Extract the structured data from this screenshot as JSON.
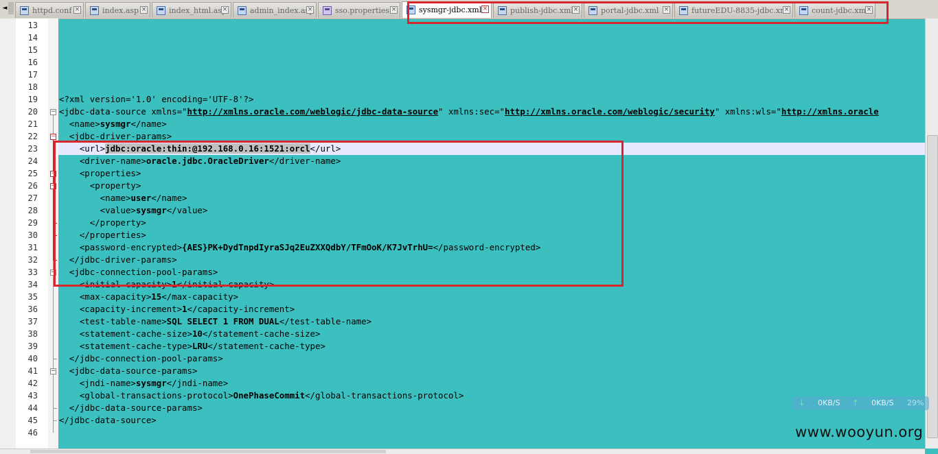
{
  "tabs": [
    {
      "label": "httpd.conf",
      "icon": "file-icon"
    },
    {
      "label": "index.asp",
      "icon": "file-icon"
    },
    {
      "label": "index_html.asp",
      "icon": "file-icon"
    },
    {
      "label": "admin_index.asp",
      "icon": "file-icon"
    },
    {
      "label": "sso.properties",
      "icon": "properties-file-icon"
    },
    {
      "label": "sysmgr-jdbc.xml",
      "icon": "file-icon",
      "active": true
    },
    {
      "label": "publish-jdbc.xml",
      "icon": "file-icon"
    },
    {
      "label": "portal-jdbc.xml",
      "icon": "file-icon"
    },
    {
      "label": "futureEDU-8835-jdbc.xml",
      "icon": "file-icon"
    },
    {
      "label": "count-jdbc.xml",
      "icon": "file-icon"
    }
  ],
  "editor": {
    "background": "#3cbfbf",
    "highlight_color": "#d8262c",
    "lines": [
      {
        "n": "13",
        "text": ""
      },
      {
        "n": "14",
        "text": ""
      },
      {
        "n": "15",
        "text": ""
      },
      {
        "n": "16",
        "text": ""
      },
      {
        "n": "17",
        "text": ""
      },
      {
        "n": "18",
        "text": ""
      },
      {
        "n": "19",
        "text": "<?xml version='1.0' encoding='UTF-8'?>"
      },
      {
        "n": "20",
        "text": "<jdbc-data-source xmlns=\"http://xmlns.oracle.com/weblogic/jdbc-data-source\" xmlns:sec=\"http://xmlns.oracle.com/weblogic/security\" xmlns:wls=\"http://xmlns.oracle"
      },
      {
        "n": "21",
        "text": "  <name>sysmgr</name>"
      },
      {
        "n": "22",
        "text": "  <jdbc-driver-params>"
      },
      {
        "n": "23",
        "text": "    <url>jdbc:oracle:thin:@192.168.0.16:1521:orcl</url>"
      },
      {
        "n": "24",
        "text": "    <driver-name>oracle.jdbc.OracleDriver</driver-name>"
      },
      {
        "n": "25",
        "text": "    <properties>"
      },
      {
        "n": "26",
        "text": "      <property>"
      },
      {
        "n": "27",
        "text": "        <name>user</name>"
      },
      {
        "n": "28",
        "text": "        <value>sysmgr</value>"
      },
      {
        "n": "29",
        "text": "      </property>"
      },
      {
        "n": "30",
        "text": "    </properties>"
      },
      {
        "n": "31",
        "text": "    <password-encrypted>{AES}PK+DydTnpdIyraSJq2EuZXXQdbY/TFmOoK/K7JvTrhU=</password-encrypted>"
      },
      {
        "n": "32",
        "text": "  </jdbc-driver-params>"
      },
      {
        "n": "33",
        "text": "  <jdbc-connection-pool-params>"
      },
      {
        "n": "34",
        "text": "    <initial-capacity>1</initial-capacity>"
      },
      {
        "n": "35",
        "text": "    <max-capacity>15</max-capacity>"
      },
      {
        "n": "36",
        "text": "    <capacity-increment>1</capacity-increment>"
      },
      {
        "n": "37",
        "text": "    <test-table-name>SQL SELECT 1 FROM DUAL</test-table-name>"
      },
      {
        "n": "38",
        "text": "    <statement-cache-size>10</statement-cache-size>"
      },
      {
        "n": "39",
        "text": "    <statement-cache-type>LRU</statement-cache-type>"
      },
      {
        "n": "40",
        "text": "  </jdbc-connection-pool-params>"
      },
      {
        "n": "41",
        "text": "  <jdbc-data-source-params>"
      },
      {
        "n": "42",
        "text": "    <jndi-name>sysmgr</jndi-name>"
      },
      {
        "n": "43",
        "text": "    <global-transactions-protocol>OnePhaseCommit</global-transactions-protocol>"
      },
      {
        "n": "44",
        "text": "  </jdbc-data-source-params>"
      },
      {
        "n": "45",
        "text": "</jdbc-data-source>"
      },
      {
        "n": "46",
        "text": ""
      }
    ]
  },
  "netspeed": {
    "down": "0KB/S",
    "up": "0KB/S",
    "percent": "29%"
  },
  "watermark": "www.wooyun.org"
}
